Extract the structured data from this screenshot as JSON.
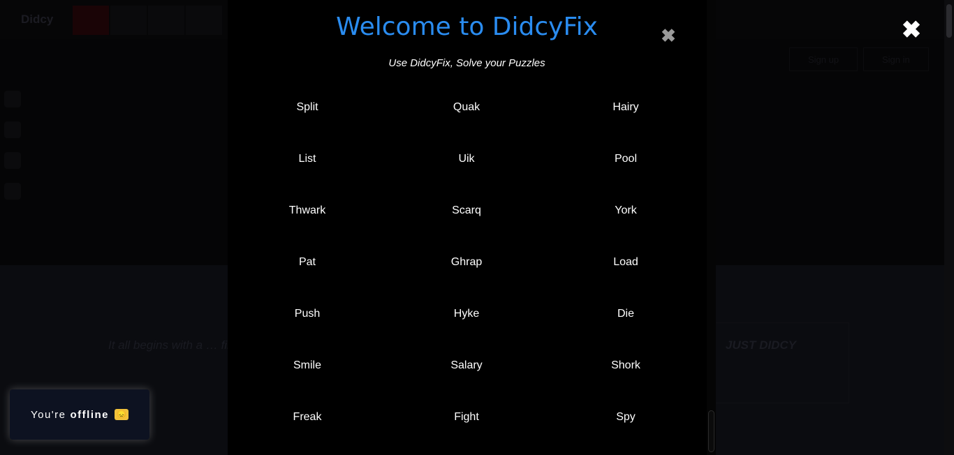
{
  "background": {
    "logo": "Didcy",
    "header_buttons": [
      "Sign up",
      "Sign in"
    ],
    "intro_text": "It all begins with a … files, web apps, websites, and more … what do you want to buy, sell, buy, host …",
    "intro_bold": "JUST DIDCY"
  },
  "page_close_glyph": "✖",
  "modal": {
    "title": "Welcome to DidcyFix",
    "subtitle": "Use DidcyFix, Solve your Puzzles",
    "close_glyph": "✖",
    "items": [
      "Split",
      "Quak",
      "Hairy",
      "List",
      "Uik",
      "Pool",
      "Thwark",
      "Scarq",
      "York",
      "Pat",
      "Ghrap",
      "Load",
      "Push",
      "Hyke",
      "Die",
      "Smile",
      "Salary",
      "Shork",
      "Freak",
      "Fight",
      "Spy"
    ]
  },
  "toast": {
    "prefix": "You're",
    "status": "offline",
    "emoji": "😞"
  },
  "colors": {
    "title": "#2a8cf0",
    "modal_bg": "#000000",
    "toast_bg": "#0d1221"
  }
}
